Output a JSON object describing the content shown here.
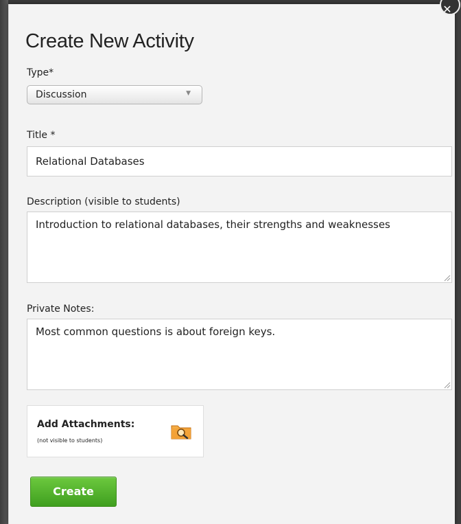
{
  "dialog": {
    "title": "Create New Activity"
  },
  "type": {
    "label": "Type*",
    "selected": "Discussion"
  },
  "title_field": {
    "label": "Title *",
    "value": "Relational Databases"
  },
  "description": {
    "label": "Description (visible to students)",
    "value": "Introduction to relational databases, their strengths and weaknesses"
  },
  "private_notes": {
    "label": "Private Notes:",
    "value": "Most common questions is about foreign keys."
  },
  "attachments": {
    "heading": "Add Attachments:",
    "note": "(not visible to students)",
    "icon": "folder-search-icon"
  },
  "actions": {
    "create_label": "Create"
  },
  "colors": {
    "create_button": "#4caf2a",
    "modal_background": "#f3f3f3"
  }
}
